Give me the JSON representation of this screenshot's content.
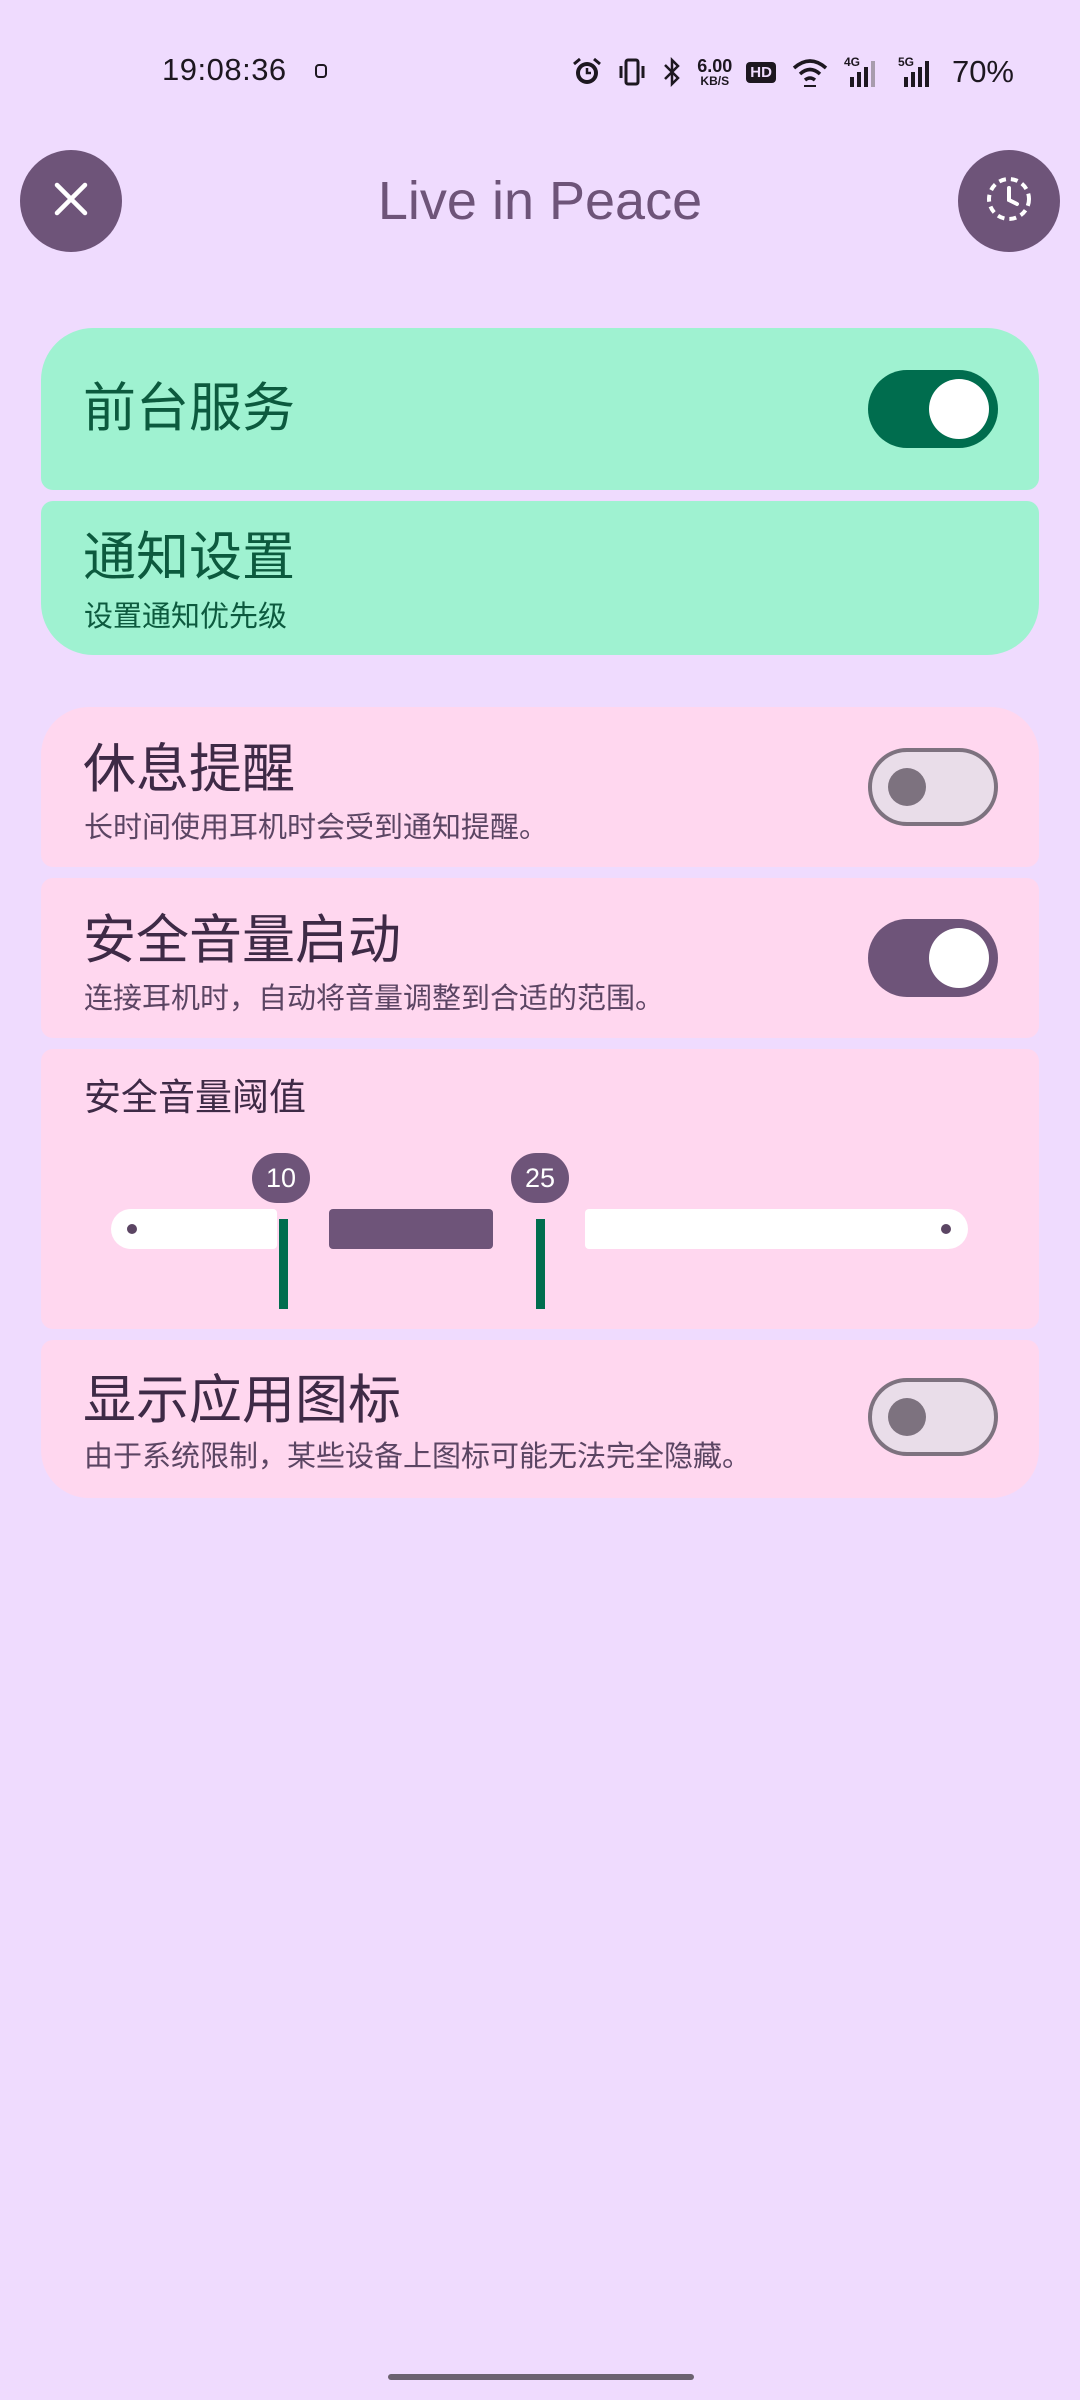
{
  "status_bar": {
    "time": "19:08:36",
    "net_speed_value": "6.00",
    "net_speed_unit": "KB/S",
    "hd_badge": "HD",
    "signal_1_label": "4G",
    "signal_2_label": "5G",
    "battery": "70%",
    "icons": [
      "alarm-icon",
      "vibrate-icon",
      "bluetooth-icon",
      "wifi-icon",
      "cell-signal-icon",
      "cell-signal-icon"
    ]
  },
  "app_bar": {
    "title": "Live in Peace",
    "close_icon": "close-icon",
    "history_icon": "history-icon"
  },
  "settings": {
    "foreground_service": {
      "title": "前台服务",
      "enabled": true
    },
    "notification_settings": {
      "title": "通知设置",
      "subtitle": "设置通知优先级"
    },
    "rest_reminder": {
      "title": "休息提醒",
      "subtitle": "长时间使用耳机时会受到通知提醒。",
      "enabled": false
    },
    "safe_volume": {
      "title": "安全音量启动",
      "subtitle": "连接耳机时，自动将音量调整到合适的范围。",
      "enabled": true
    },
    "safe_volume_threshold": {
      "title": "安全音量阈值",
      "min_value": "10",
      "max_value": "25"
    },
    "show_app_icon": {
      "title": "显示应用图标",
      "subtitle": "由于系统限制，某些设备上图标可能无法完全隐藏。",
      "enabled": false
    }
  },
  "colors": {
    "background": "#efdbfe",
    "primary": "#6e5479",
    "green_card": "#9ff2d1",
    "pink_card": "#ffd7ef",
    "switch_green": "#006d4e"
  }
}
